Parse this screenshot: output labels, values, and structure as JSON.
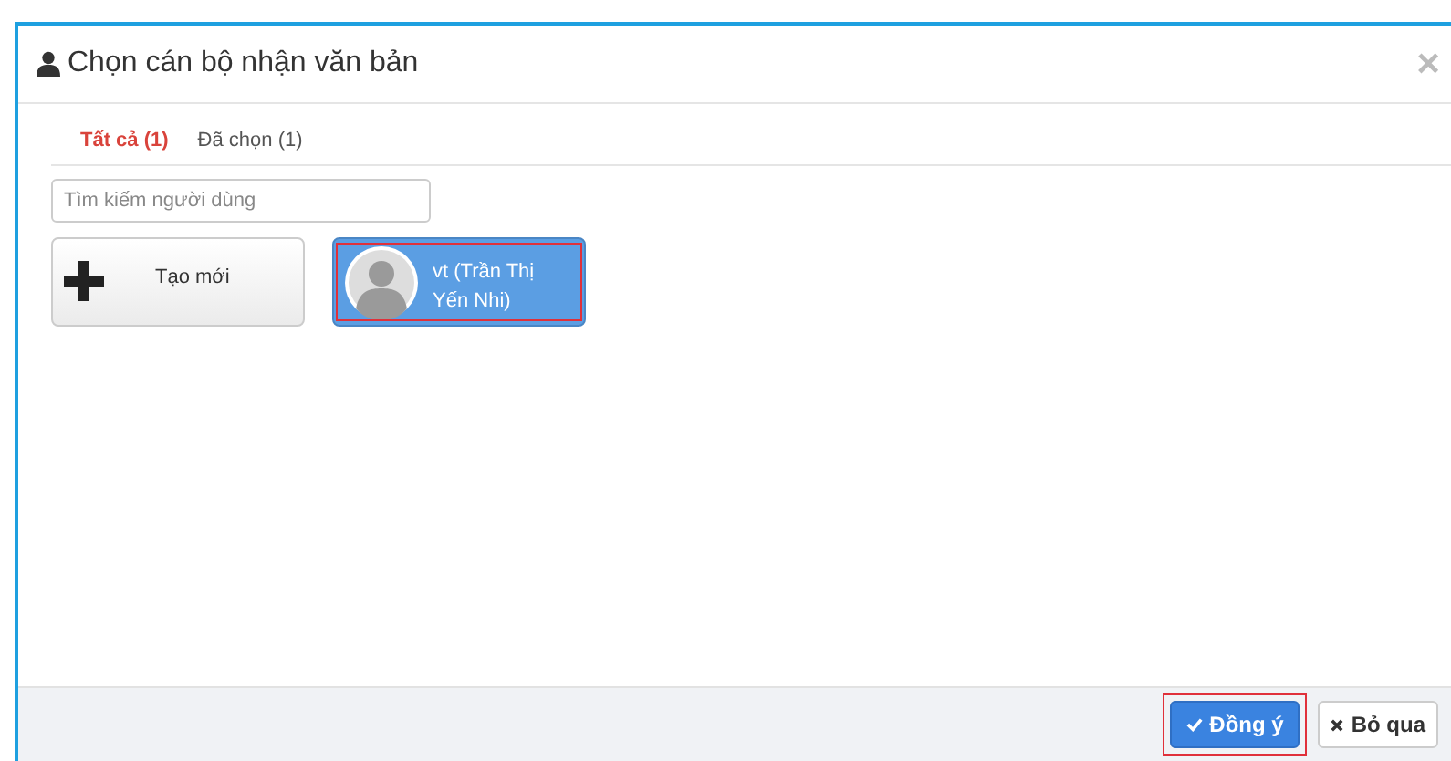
{
  "dialog": {
    "title": "Chọn cán bộ nhận văn bản",
    "close": "×",
    "tabs": [
      {
        "label": "Tất cả (1)",
        "selected": true
      },
      {
        "label": "Đã chọn (1)",
        "selected": false
      }
    ],
    "search": {
      "placeholder": "Tìm kiếm người dùng"
    },
    "cards": [
      {
        "kind": "create",
        "label": "Tạo mới",
        "selected": false,
        "highlighted": false
      },
      {
        "kind": "user",
        "label": "vt (Trần Thị Yến Nhi)",
        "selected": true,
        "highlighted": true
      }
    ],
    "buttons": [
      {
        "kind": "primary",
        "label": "Đồng ý",
        "highlighted": true
      },
      {
        "kind": "default",
        "label": "Bỏ qua",
        "highlighted": false
      }
    ]
  }
}
